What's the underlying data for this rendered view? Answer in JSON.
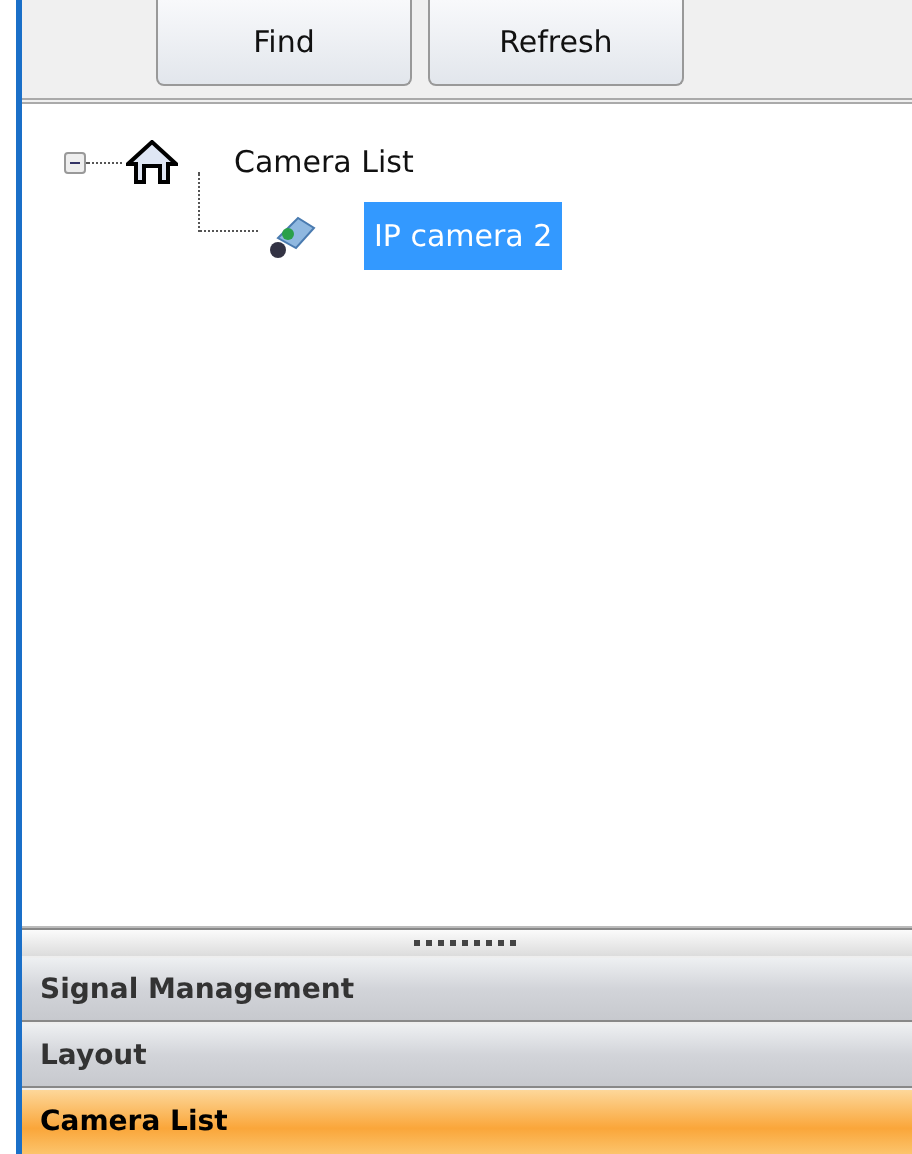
{
  "toolbar": {
    "buttons": [
      "Find",
      "Refresh"
    ]
  },
  "tree": [
    {
      "label": "Camera List",
      "kind": "home",
      "expanded": true,
      "selected": false,
      "children": [
        {
          "label": "IP camera 2",
          "kind": "camera",
          "selected": true
        }
      ]
    }
  ],
  "nav": [
    {
      "label": "Signal Management",
      "selected": false
    },
    {
      "label": "Layout",
      "selected": false
    },
    {
      "label": "Camera List",
      "selected": true
    }
  ]
}
